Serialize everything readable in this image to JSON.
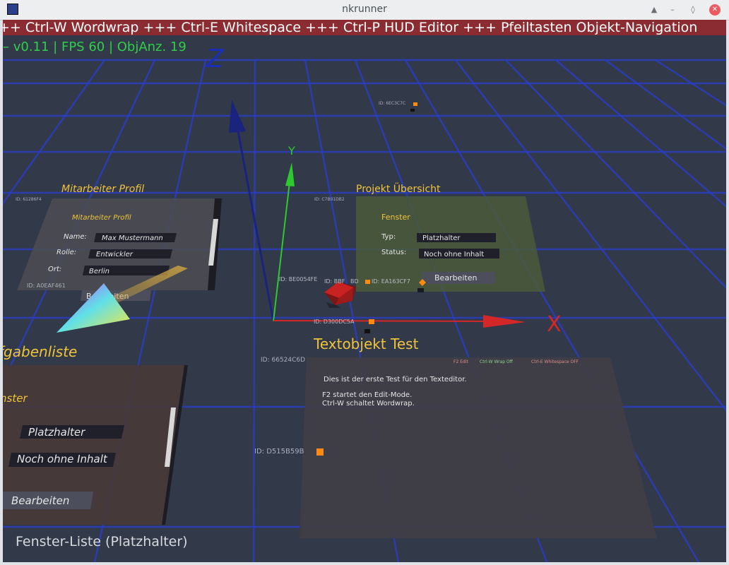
{
  "window": {
    "title": "nkrunner",
    "buttons": {
      "shade": "▲",
      "minimize": "–",
      "maximize": "◊",
      "close": "✕"
    }
  },
  "hud": {
    "ticker": "++ Ctrl-W Wordwrap +++ Ctrl-E Whitespace +++ Ctrl-P HUD Editor +++ Pfeiltasten Objekt-Navigation",
    "status": "– v0.11 | FPS 60 | ObjAnz. 19",
    "bottom_label": "Fenster-Liste (Platzhalter)"
  },
  "axes": {
    "x_label": "X",
    "y_label": "Y",
    "z_label": "Z",
    "colors": {
      "x": "#d42727",
      "y": "#2ec92e",
      "z": "#1a237e"
    }
  },
  "panels": {
    "mitarbeiter": {
      "title": "Mitarbeiter Profil",
      "id_top": "ID: 61286F4",
      "heading": "Mitarbeiter Profil",
      "name_label": "Name:",
      "name_value": "Max Mustermann",
      "role_label": "Rolle:",
      "role_value": "Entwickler",
      "place_label": "Ort:",
      "place_value": "Berlin",
      "id_bottom": "ID: A0EAF461",
      "button": "Bearbeiten"
    },
    "projekt": {
      "title": "Projekt Übersicht",
      "id_top": "ID: C7B01DB2",
      "heading": "Fenster",
      "type_label": "Typ:",
      "type_value": "Platzhalter",
      "status_label": "Status:",
      "status_value": "Noch ohne Inhalt",
      "button": "Bearbeiten"
    },
    "aufgaben": {
      "title": "fgabenliste",
      "heading": "nster",
      "field1": "Platzhalter",
      "field2": "Noch ohne Inhalt",
      "button": "Bearbeiten"
    },
    "textobjekt": {
      "title": "Textobjekt Test",
      "id_label": "ID: 66524C6D",
      "toolbar_f2": "F2 Edit",
      "toolbar_wrap": "Ctrl-W Wrap Off",
      "toolbar_ws": "Ctrl-E Whitespace OFF",
      "line1": "Dies ist der erste Test für den Texteditor.",
      "line2": "F2 startet den Edit-Mode.",
      "line3": "Ctrl-W schaltet Wordwrap."
    }
  },
  "object_ids": {
    "top": "ID: 6EC3C7C",
    "cube_a": "ID: BE0054FE",
    "cube_b": "ID: BBF",
    "cube_c": "BD",
    "projekt_obj": "ID: EA163CF7",
    "origin": "ID: D300DC5A",
    "lower": "ID: D515B59B"
  },
  "colors": {
    "background": "#323949",
    "grid": "#2a3ecf",
    "ticker_bg": "#8a2c32",
    "status_text": "#2fcf4a",
    "title_yellow": "#f0c43a",
    "marker_orange": "#ff8a10"
  }
}
